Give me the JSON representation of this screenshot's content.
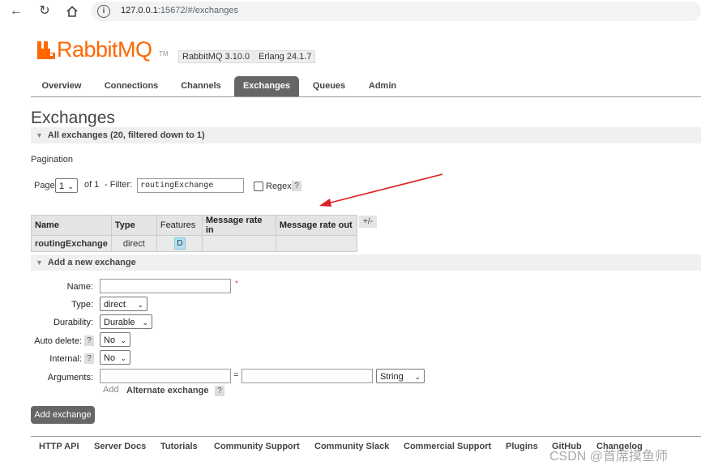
{
  "browser": {
    "url_host": "127.0.0.1",
    "url_rest": ":15672/#/exchanges"
  },
  "header": {
    "logo_text": "RabbitMQ",
    "logo_tm": "TM",
    "version_rabbit": "RabbitMQ 3.10.0",
    "version_erlang": "Erlang 24.1.7"
  },
  "tabs": [
    {
      "label": "Overview"
    },
    {
      "label": "Connections"
    },
    {
      "label": "Channels"
    },
    {
      "label": "Exchanges"
    },
    {
      "label": "Queues"
    },
    {
      "label": "Admin"
    }
  ],
  "page": {
    "title": "Exchanges",
    "section_all": "All exchanges (20, filtered down to 1)",
    "pagination_label": "Pagination",
    "page_label": "Page",
    "page_value": "1",
    "of_label": "of 1",
    "filter_label": "- Filter:",
    "filter_value": "routingExchange",
    "regex_label": "Regex",
    "help": "?"
  },
  "table": {
    "headers": [
      "Name",
      "Type",
      "Features",
      "Message rate in",
      "Message rate out"
    ],
    "plusminus": "+/-",
    "rows": [
      {
        "name": "routingExchange",
        "type": "direct",
        "feature": "D",
        "rate_in": "",
        "rate_out": ""
      }
    ]
  },
  "add_form": {
    "section": "Add a new exchange",
    "name_label": "Name:",
    "required_mark": "*",
    "type_label": "Type:",
    "type_value": "direct",
    "durability_label": "Durability:",
    "durability_value": "Durable",
    "autodelete_label": "Auto delete:",
    "autodelete_value": "No",
    "internal_label": "Internal:",
    "internal_value": "No",
    "arguments_label": "Arguments:",
    "equals": "=",
    "arg_type_value": "String",
    "add_link": "Add",
    "alternate_exchange": "Alternate exchange",
    "submit": "Add exchange"
  },
  "footer": {
    "links": [
      "HTTP API",
      "Server Docs",
      "Tutorials",
      "Community Support",
      "Community Slack",
      "Commercial Support",
      "Plugins",
      "GitHub",
      "Changelog"
    ]
  },
  "watermark": "CSDN @首席摸鱼师",
  "colors": {
    "brand": "#ff6600",
    "tab_active": "#666666",
    "annotation_arrow": "#e02020"
  }
}
